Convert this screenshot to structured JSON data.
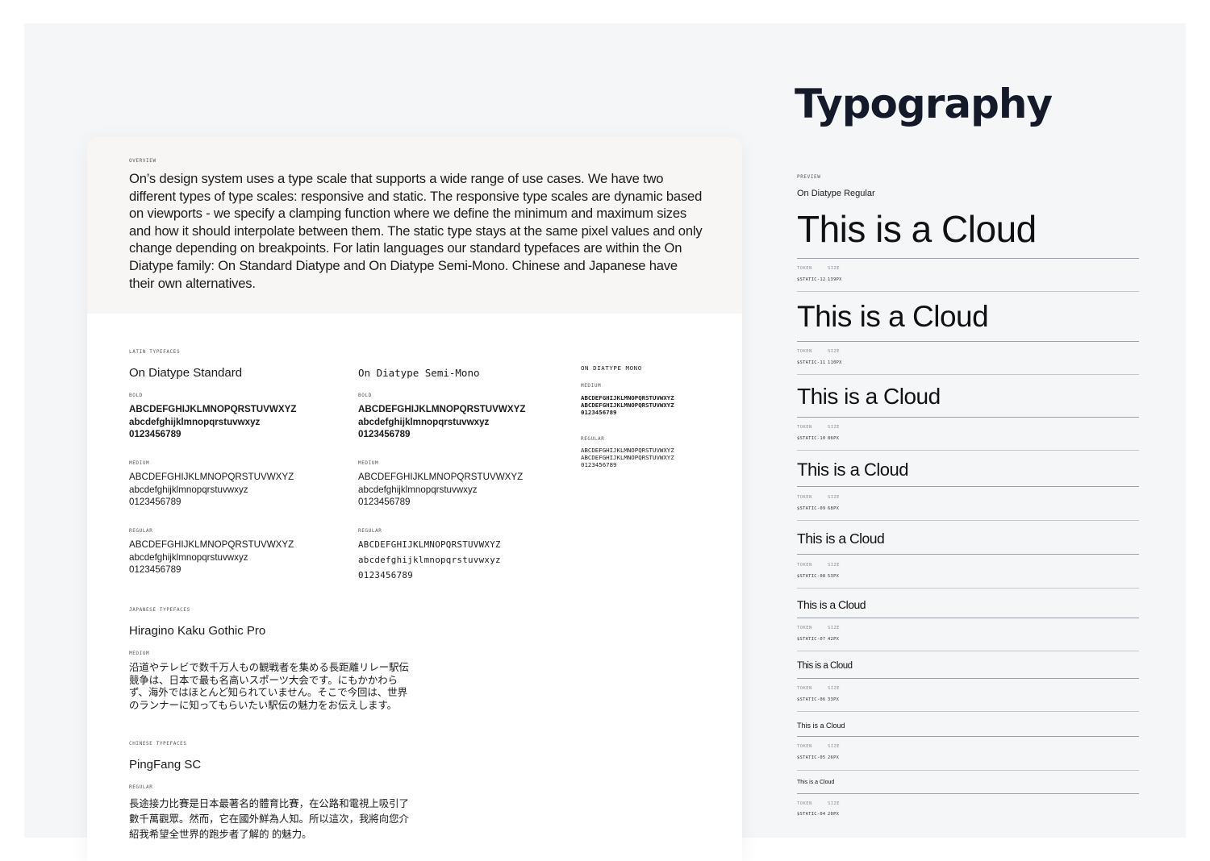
{
  "page_title": "Typography",
  "overview": {
    "label": "OVERVIEW",
    "text": "On’s design system uses a type scale that supports a wide range of use cases. We have two different types of type scales: responsive and static. The responsive type scales are dynamic based on viewports - we specify a clamping function where we define the minimum and maximum sizes and how it should interpolate between them. The static type stays at the same pixel values and only change depending on breakpoints. For latin languages our standard typefaces are within the On Diatype family: On Standard Diatype and On Diatype Semi-Mono. Chinese and Japanese have their own alternatives."
  },
  "latin": {
    "label": "LATIN TYPEFACES",
    "standard": {
      "name": "On Diatype Standard",
      "weights": [
        {
          "label": "BOLD",
          "upper": "ABCDEFGHIJKLMNOPQRSTUVWXYZ",
          "lower": "abcdefghijklmnopqrstuvwxyz",
          "digits": "0123456789"
        },
        {
          "label": "MEDIUM",
          "upper": "ABCDEFGHIJKLMNOPQRSTUVWXYZ",
          "lower": "abcdefghijklmnopqrstuvwxyz",
          "digits": "0123456789"
        },
        {
          "label": "REGULAR",
          "upper": "ABCDEFGHIJKLMNOPQRSTUVWXYZ",
          "lower": "abcdefghijklmnopqrstuvwxyz",
          "digits": "0123456789"
        }
      ]
    },
    "semimono": {
      "name": "On Diatype Semi-Mono",
      "weights": [
        {
          "label": "BOLD",
          "upper": "ABCDEFGHIJKLMNOPQRSTUVWXYZ",
          "lower": "abcdefghijklmnopqrstuvwxyz",
          "digits": "0123456789"
        },
        {
          "label": "MEDIUM",
          "upper": "ABCDEFGHIJKLMNOPQRSTUVWXYZ",
          "lower": "abcdefghijklmnopqrstuvwxyz",
          "digits": "0123456789"
        },
        {
          "label": "REGULAR",
          "upper": "ABCDEFGHIJKLMNOPQRSTUVWXYZ",
          "lower": "abcdefghijklmnopqrstuvwxyz",
          "digits": "0123456789"
        }
      ]
    },
    "mono": {
      "name": "ON DIATYPE MONO",
      "weights": [
        {
          "label": "MEDIUM",
          "line1": "ABCDEFGHIJKLMNOPQRSTUVWXYZ",
          "line2": "ABCDEFGHIJKLMNOPQRSTUVWXYZ",
          "digits": "0123456789"
        },
        {
          "label": "REGULAR",
          "line1": "ABCDEFGHIJKLMNOPQRSTUVWXYZ",
          "line2": "ABCDEFGHIJKLMNOPQRSTUVWXYZ",
          "digits": "0123456789"
        }
      ]
    }
  },
  "japanese": {
    "label": "JAPANESE TYPEFACES",
    "name": "Hiragino Kaku Gothic Pro",
    "weight": "MEDIUM",
    "lines": [
      "沿道やテレビで数千万人もの観戦者を集める長距離リレー駅伝",
      "競争は、日本で最も名高いスポーツ大会です。にもかかわら",
      "ず、海外ではほとんど知られていません。そこで今回は、世界",
      "のランナーに知ってもらいたい駅伝の魅力をお伝えします。"
    ]
  },
  "chinese": {
    "label": "CHINESE TYPEFACES",
    "name": "PingFang SC",
    "weight": "REGULAR",
    "lines": [
      "長途接力比賽是日本最著名的體育比賽，在公路和電視上吸引了",
      "數千萬觀眾。然而，它在國外鮮為人知。所以這次，我將向您介",
      "紹我希望全世界的跑步者了解的 的魅力。"
    ]
  },
  "preview": {
    "label": "PREVIEW",
    "font": "On Diatype Regular",
    "sample_text": "This is a Cloud",
    "token_label": "TOKEN",
    "size_label": "SIZE",
    "rows": [
      {
        "token": "$STATIC-12",
        "size": "139PX"
      },
      {
        "token": "$STATIC-11",
        "size": "110PX"
      },
      {
        "token": "$STATIC-10",
        "size": "86PX"
      },
      {
        "token": "$STATIC-09",
        "size": "68PX"
      },
      {
        "token": "$STATIC-08",
        "size": "53PX"
      },
      {
        "token": "$STATIC-07",
        "size": "42PX"
      },
      {
        "token": "$STATIC-06",
        "size": "33PX"
      },
      {
        "token": "$STATIC-05",
        "size": "26PX"
      },
      {
        "token": "$STATIC-04",
        "size": "20PX"
      }
    ]
  }
}
